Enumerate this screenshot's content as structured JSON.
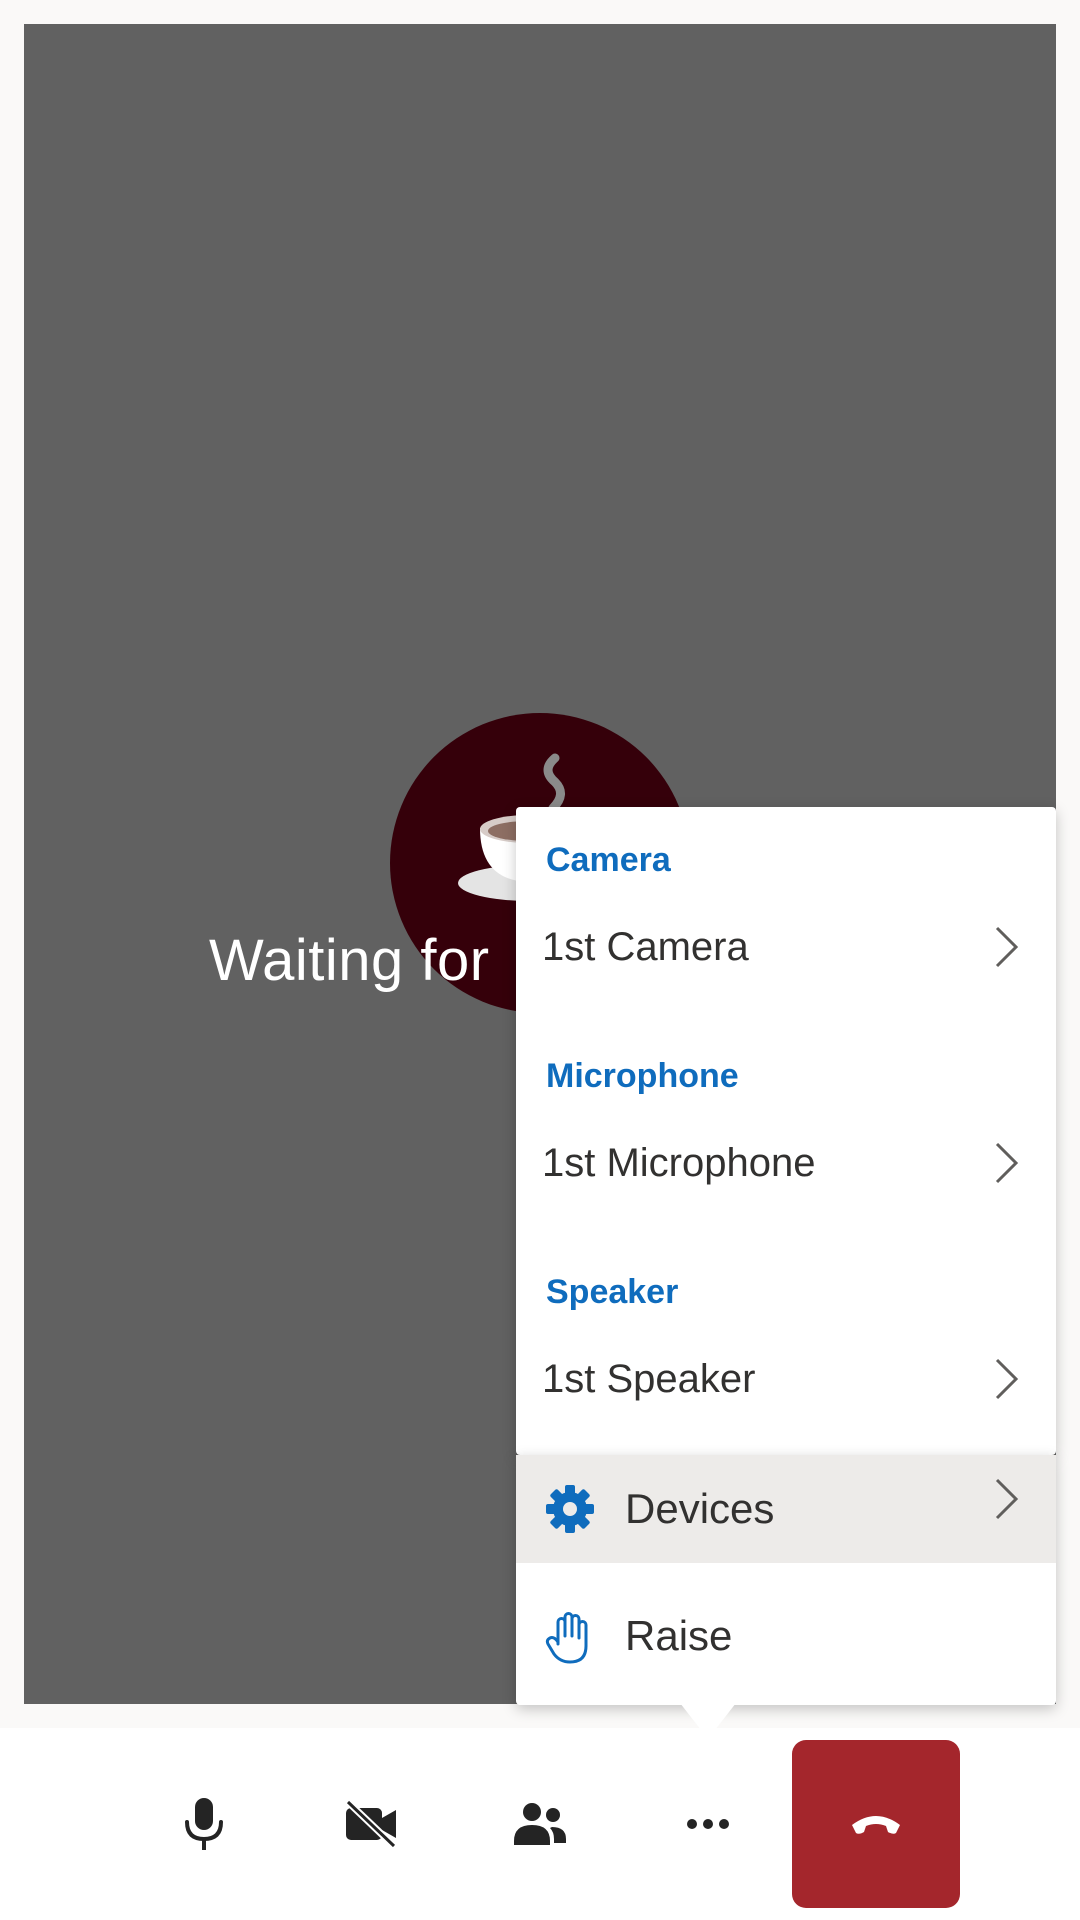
{
  "stage": {
    "waiting_text": "Waiting for",
    "avatar_icon": "coffee-cup-icon"
  },
  "devices_menu": {
    "sections": [
      {
        "title": "Camera",
        "selected": "1st Camera"
      },
      {
        "title": "Microphone",
        "selected": "1st Microphone"
      },
      {
        "title": "Speaker",
        "selected": "1st Speaker"
      }
    ]
  },
  "more_menu": {
    "items": [
      {
        "label": "Devices",
        "icon": "gear-icon"
      },
      {
        "label": "Raise",
        "icon": "raise-hand-icon"
      }
    ]
  },
  "controls": {
    "microphone_icon": "microphone-icon",
    "camera_icon": "camera-off-icon",
    "people_icon": "people-icon",
    "more_icon": "more-icon",
    "hangup_icon": "hangup-icon"
  },
  "colors": {
    "accent": "#0f6cbd",
    "hangup": "#a4262c",
    "stage": "#616161",
    "avatar_bg": "#35000a"
  }
}
